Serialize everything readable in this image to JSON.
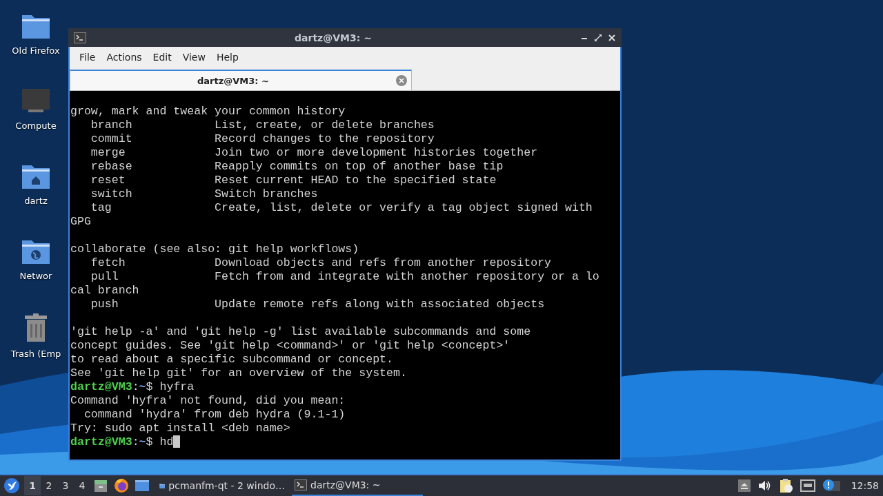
{
  "desktop_icons": [
    {
      "label": "Old Firefox",
      "kind": "folder"
    },
    {
      "label": "Compute",
      "kind": "computer"
    },
    {
      "label": "dartz",
      "kind": "home"
    },
    {
      "label": "Networ",
      "kind": "network"
    },
    {
      "label": "Trash (Emp",
      "kind": "trash"
    }
  ],
  "window": {
    "title": "dartz@VM3: ~",
    "menu": [
      "File",
      "Actions",
      "Edit",
      "View",
      "Help"
    ],
    "tabs": [
      {
        "label": "dartz@VM3: ~",
        "selected": true
      }
    ],
    "terminal": {
      "lines": [
        {
          "kind": "output",
          "text": "grow, mark and tweak your common history"
        },
        {
          "kind": "output",
          "text": "   branch            List, create, or delete branches"
        },
        {
          "kind": "output",
          "text": "   commit            Record changes to the repository"
        },
        {
          "kind": "output",
          "text": "   merge             Join two or more development histories together"
        },
        {
          "kind": "output",
          "text": "   rebase            Reapply commits on top of another base tip"
        },
        {
          "kind": "output",
          "text": "   reset             Reset current HEAD to the specified state"
        },
        {
          "kind": "output",
          "text": "   switch            Switch branches"
        },
        {
          "kind": "output",
          "text": "   tag               Create, list, delete or verify a tag object signed with"
        },
        {
          "kind": "output",
          "text": "GPG"
        },
        {
          "kind": "blank"
        },
        {
          "kind": "output",
          "text": "collaborate (see also: git help workflows)"
        },
        {
          "kind": "output",
          "text": "   fetch             Download objects and refs from another repository"
        },
        {
          "kind": "output",
          "text": "   pull              Fetch from and integrate with another repository or a lo"
        },
        {
          "kind": "output",
          "text": "cal branch"
        },
        {
          "kind": "output",
          "text": "   push              Update remote refs along with associated objects"
        },
        {
          "kind": "blank"
        },
        {
          "kind": "output",
          "text": "'git help -a' and 'git help -g' list available subcommands and some"
        },
        {
          "kind": "output",
          "text": "concept guides. See 'git help <command>' or 'git help <concept>'"
        },
        {
          "kind": "output",
          "text": "to read about a specific subcommand or concept."
        },
        {
          "kind": "output",
          "text": "See 'git help git' for an overview of the system."
        },
        {
          "kind": "prompt",
          "user": "dartz@VM3",
          "colon": ":",
          "path": "~",
          "symbol": "$",
          "command": "hyfra",
          "cursor": false
        },
        {
          "kind": "output",
          "text": "Command 'hyfra' not found, did you mean:"
        },
        {
          "kind": "output",
          "text": "  command 'hydra' from deb hydra (9.1-1)"
        },
        {
          "kind": "output",
          "text": "Try: sudo apt install <deb name>"
        },
        {
          "kind": "prompt",
          "user": "dartz@VM3",
          "colon": ":",
          "path": "~",
          "symbol": "$",
          "command": "hd",
          "cursor": true
        }
      ]
    }
  },
  "taskbar": {
    "desktops": [
      {
        "label": "1",
        "selected": true
      },
      {
        "label": "2",
        "selected": false
      },
      {
        "label": "3",
        "selected": false
      },
      {
        "label": "4",
        "selected": false
      }
    ],
    "tasks": [
      {
        "label": "pcmanfm-qt - 2 windo…",
        "kind": "folder",
        "selected": false
      },
      {
        "label": "dartz@VM3: ~",
        "kind": "terminal",
        "selected": true
      }
    ],
    "clock": "12:58"
  }
}
